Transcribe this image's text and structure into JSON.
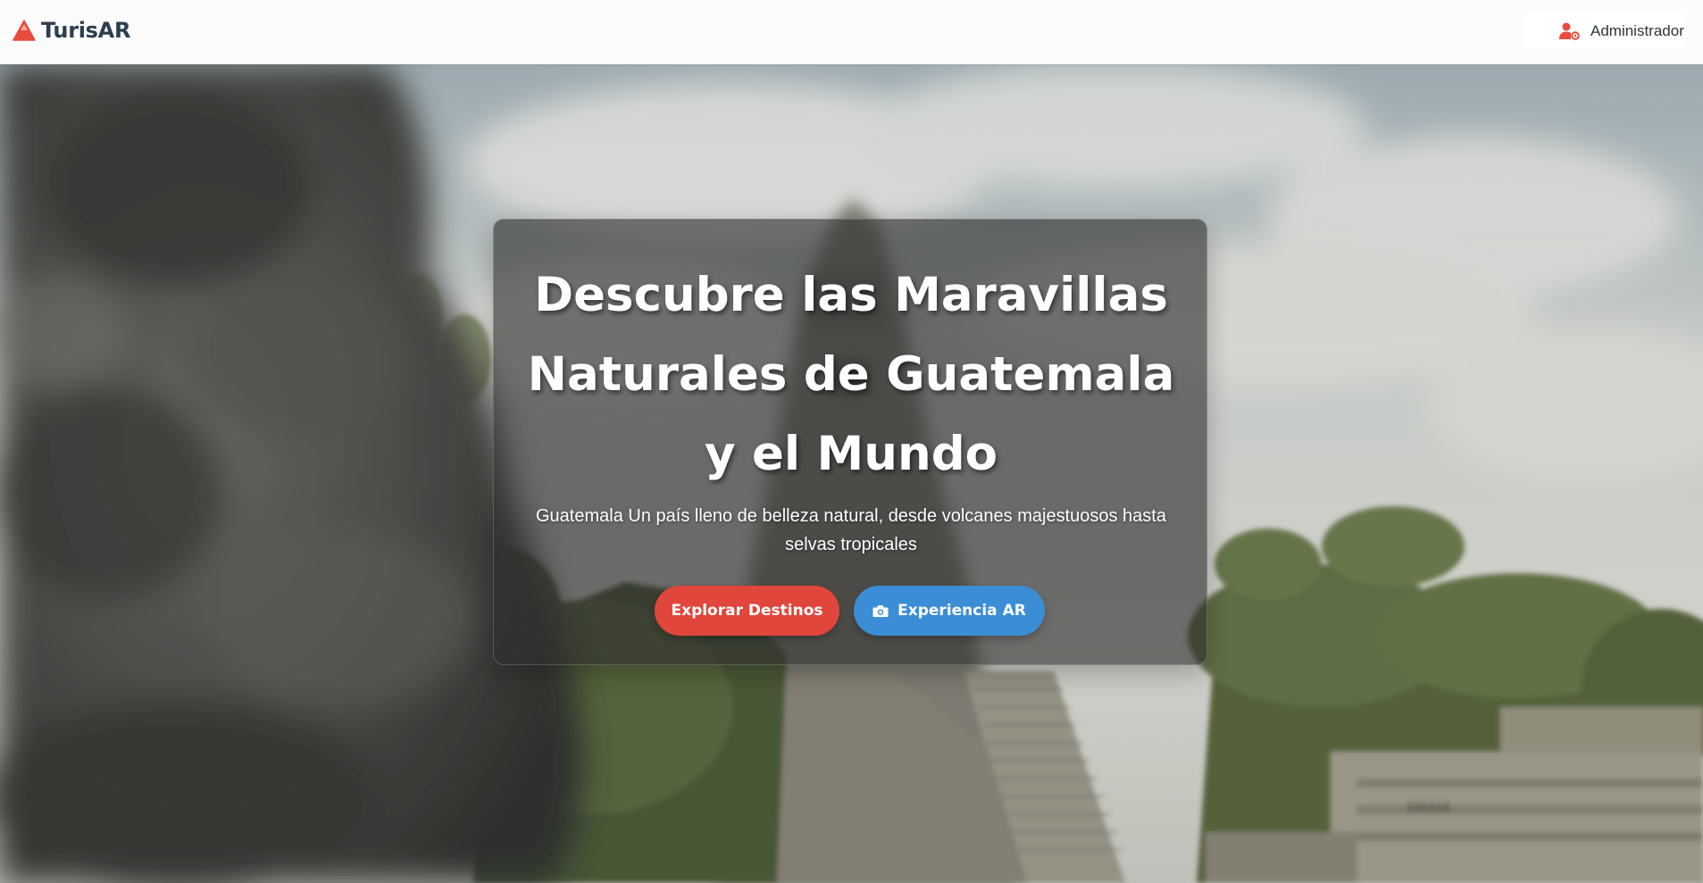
{
  "navbar": {
    "brand_icon": "mountain-triangle-icon",
    "brand_name": "TurisAR",
    "admin_icon": "user-gear-icon",
    "admin_label": "Administrador"
  },
  "hero": {
    "title": "Descubre las Maravillas Naturales de Guatemala y el Mundo",
    "subtitle": "Guatemala Un país lleno de belleza natural, desde volcanes majestuosos hasta selvas tropicales",
    "explore_button": "Explorar Destinos",
    "ar_button_icon": "camera-icon",
    "ar_button": "Experiencia AR"
  },
  "colors": {
    "brand_red": "#e74c3c",
    "brand_text": "#2c3e50",
    "explore_button": "#e0463b",
    "ar_button": "#3b8ed6",
    "card_overlay": "rgba(45,45,45,0.62)"
  }
}
